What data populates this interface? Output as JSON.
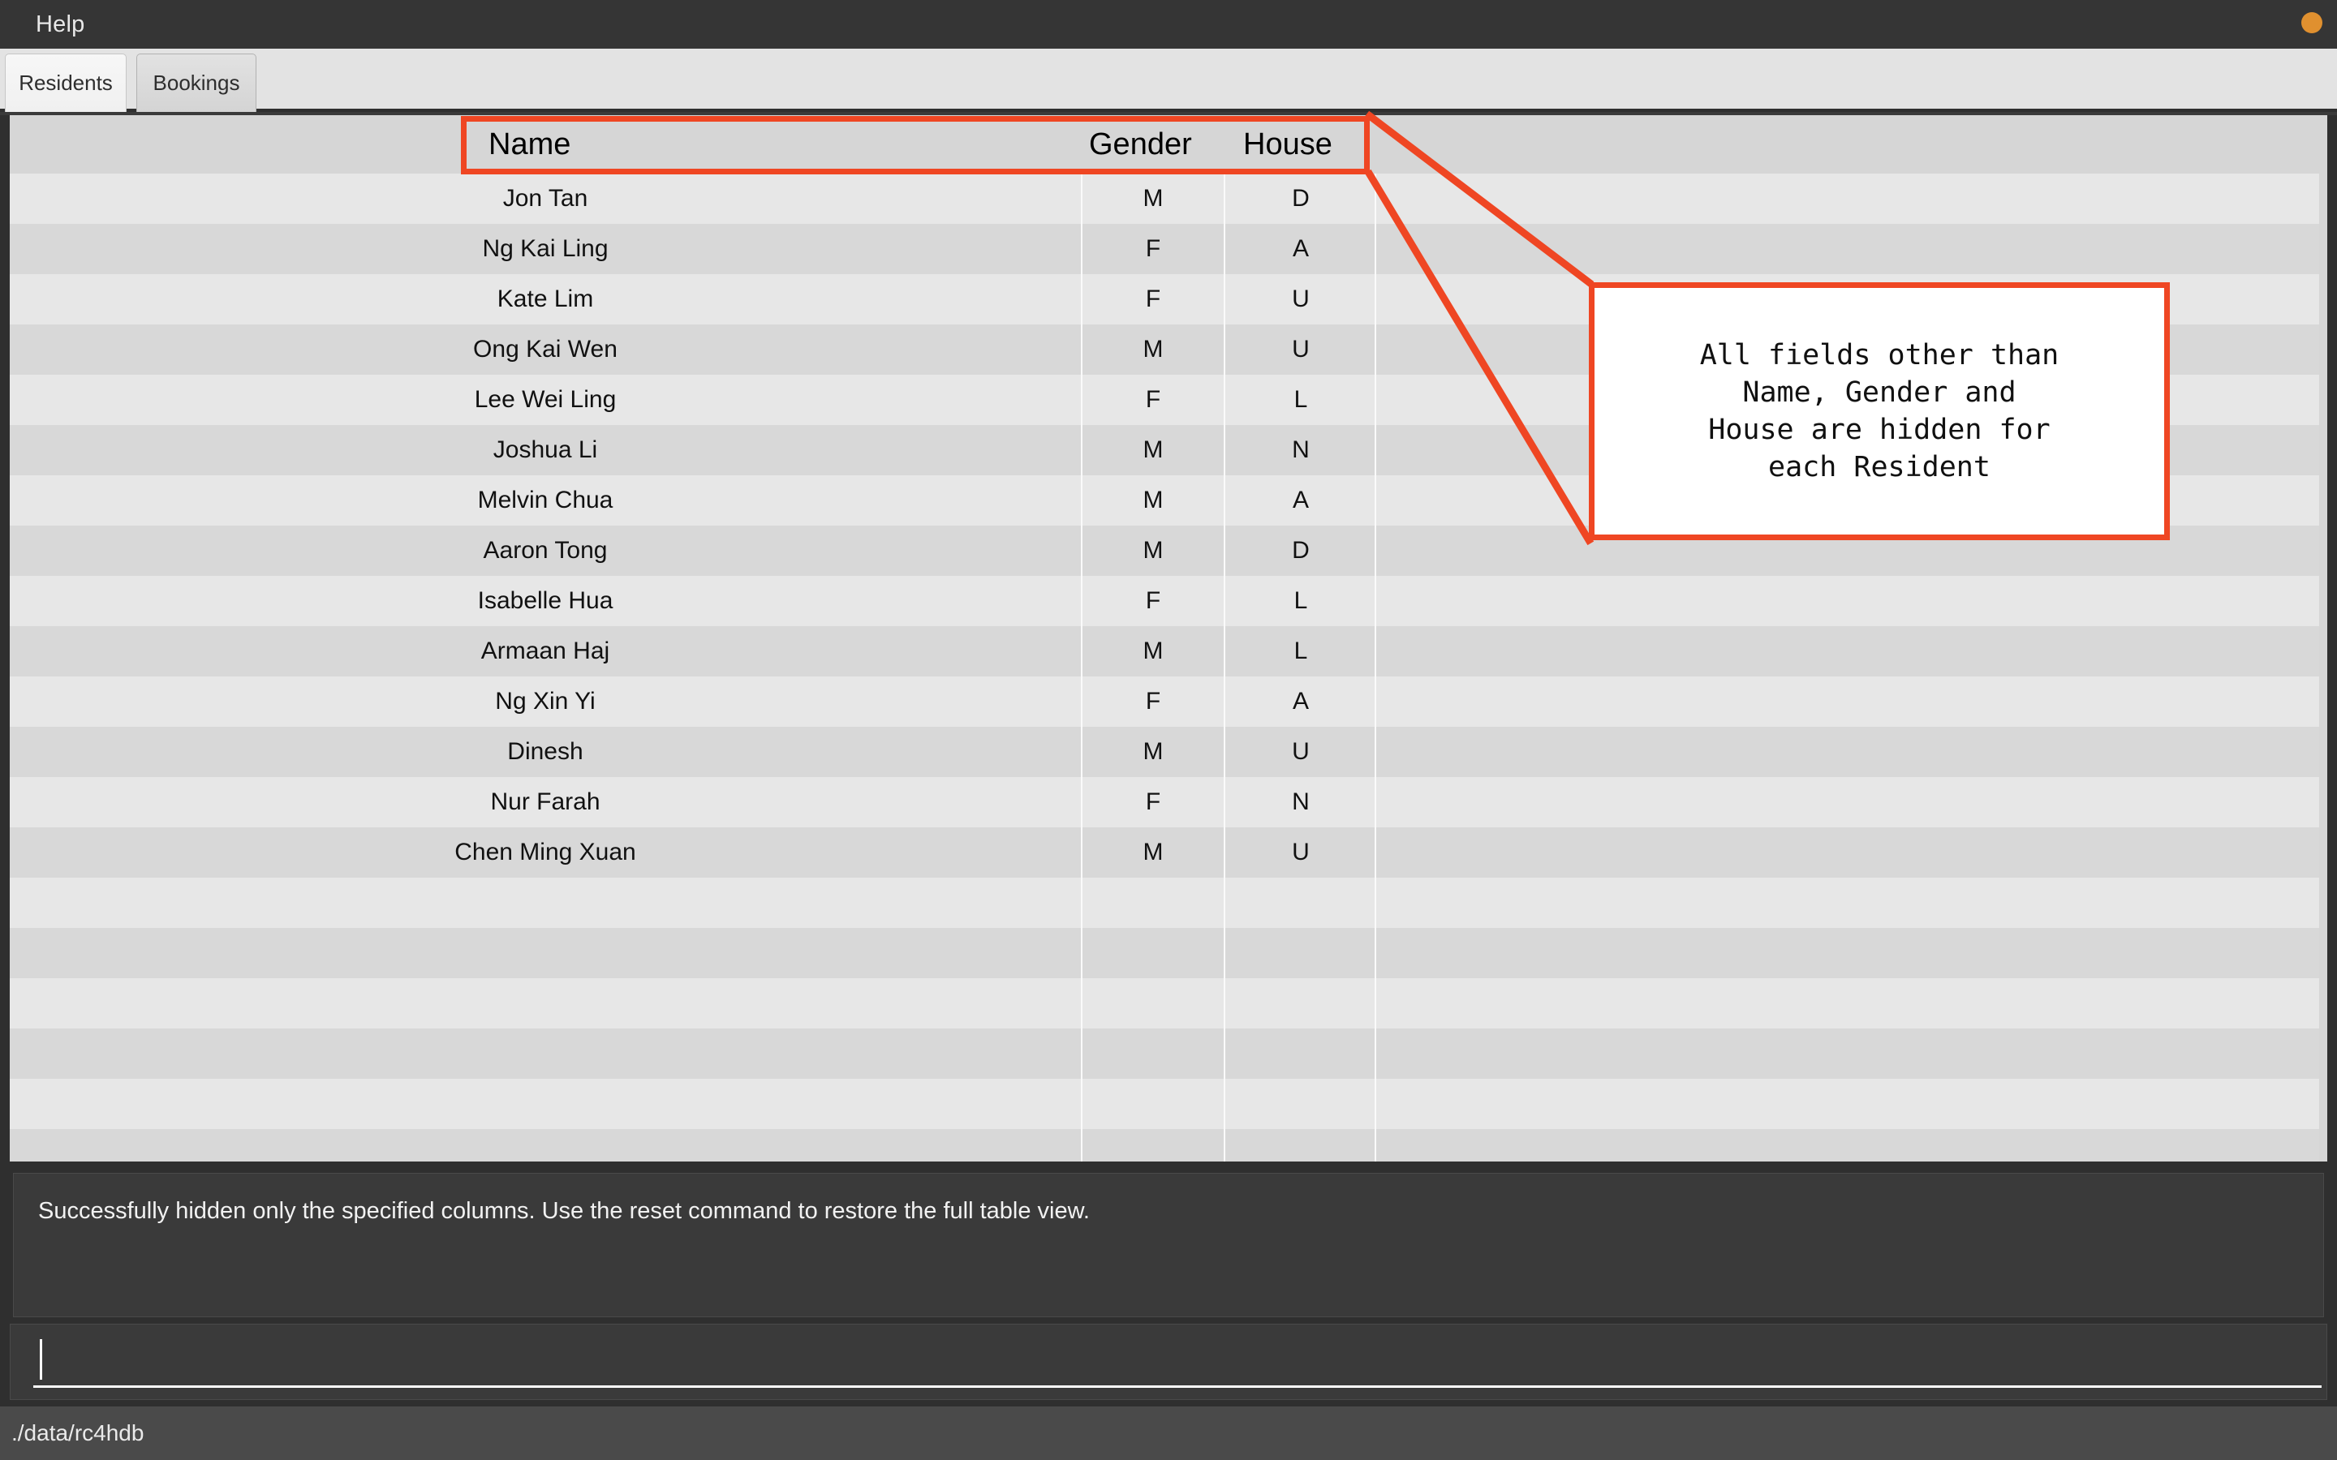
{
  "window": {
    "menu_items": [
      "Help"
    ],
    "dot_icon": "window-minimize-dot"
  },
  "tabs": [
    {
      "label": "Residents",
      "active": true
    },
    {
      "label": "Bookings",
      "active": false
    }
  ],
  "table": {
    "columns": [
      "Name",
      "Gender",
      "House"
    ],
    "rows": [
      {
        "name": "Jon Tan",
        "gender": "M",
        "house": "D"
      },
      {
        "name": "Ng Kai Ling",
        "gender": "F",
        "house": "A"
      },
      {
        "name": "Kate Lim",
        "gender": "F",
        "house": "U"
      },
      {
        "name": "Ong Kai Wen",
        "gender": "M",
        "house": "U"
      },
      {
        "name": "Lee Wei Ling",
        "gender": "F",
        "house": "L"
      },
      {
        "name": "Joshua Li",
        "gender": "M",
        "house": "N"
      },
      {
        "name": "Melvin Chua",
        "gender": "M",
        "house": "A"
      },
      {
        "name": "Aaron Tong",
        "gender": "M",
        "house": "D"
      },
      {
        "name": "Isabelle Hua",
        "gender": "F",
        "house": "L"
      },
      {
        "name": "Armaan Haj",
        "gender": "M",
        "house": "L"
      },
      {
        "name": "Ng Xin Yi",
        "gender": "F",
        "house": "A"
      },
      {
        "name": "Dinesh",
        "gender": "M",
        "house": "U"
      },
      {
        "name": "Nur Farah",
        "gender": "F",
        "house": "N"
      },
      {
        "name": "Chen Ming Xuan",
        "gender": "M",
        "house": "U"
      }
    ],
    "empty_row_count": 6
  },
  "result": {
    "message": "Successfully hidden only the specified columns. Use the reset command to restore the full table view."
  },
  "command": {
    "value": "",
    "placeholder": ""
  },
  "status": {
    "path": "./data/rc4hdb"
  },
  "annotation": {
    "accent_color": "#ef4623",
    "callout_text": "All fields other than\nName, Gender and\nHouse are hidden for\neach Resident",
    "highlight_target": "table-header-row"
  }
}
